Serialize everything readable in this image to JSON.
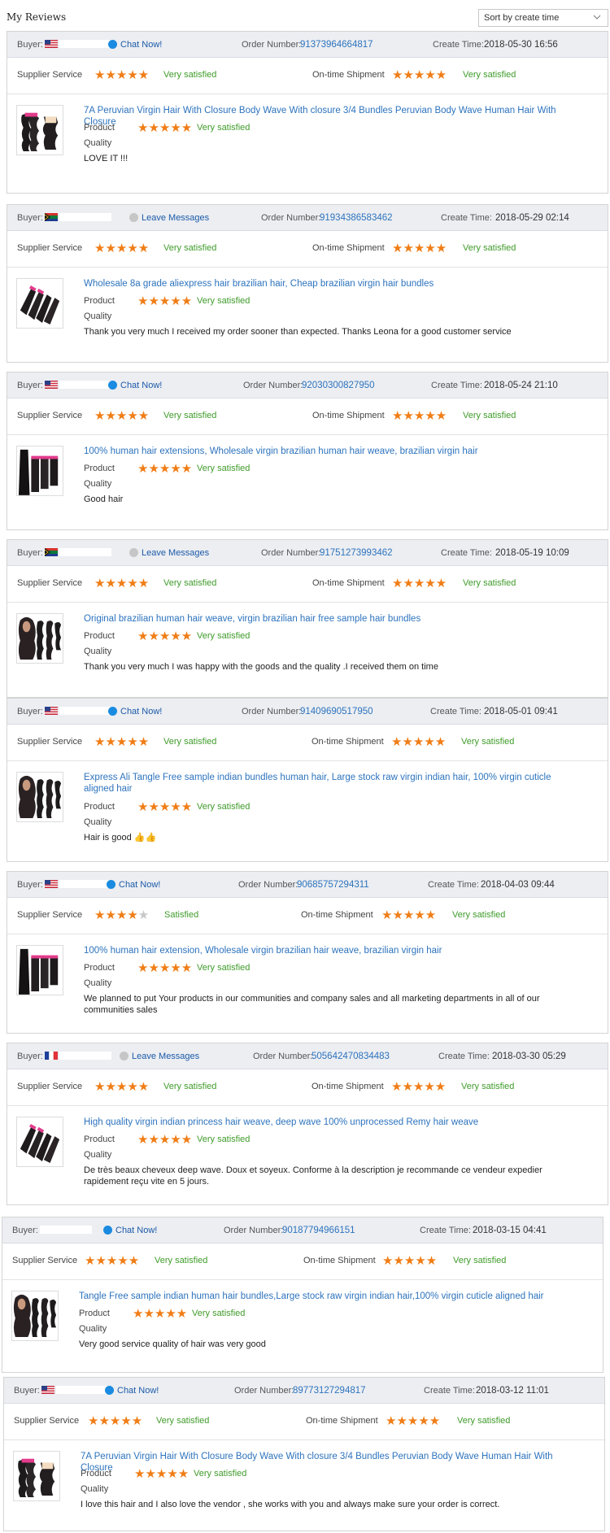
{
  "page": {
    "title": "My Reviews",
    "sort": "Sort by create time"
  },
  "labels": {
    "buyer": "Buyer:",
    "order_number": "Order Number:",
    "create_time": "Create Time:",
    "supplier_service": "Supplier Service",
    "on_time_shipment": "On-time Shipment",
    "product": "Product",
    "quality": "Quality"
  },
  "colors": {
    "header_bg": "#eceef2",
    "link": "#2d73bd",
    "star": "#f07d16",
    "satisfied": "#3f9b2a"
  },
  "reviews": [
    {
      "buyer_flag": "us-flag",
      "contact": "Chat Now!",
      "contact_icon": "chat-icon",
      "order_number": "91373964664817",
      "create_time": "2018-05-30 16:56",
      "supplier_stars": 5,
      "supplier_text": "Very satisfied",
      "shipment_stars": 5,
      "shipment_text": "Very satisfied",
      "product_title": "7A Peruvian Virgin Hair With Closure Body Wave With closure 3/4 Bundles Peruvian Body Wave Human Hair With Closure",
      "product_stars": 5,
      "product_text": "Very satisfied",
      "comment": "LOVE IT !!!",
      "thumb": "bundles-closure"
    },
    {
      "buyer_flag": "za-flag",
      "contact": "Leave Messages",
      "contact_icon": "message-icon",
      "order_number": "91934386583462",
      "create_time": "2018-05-29 02:14",
      "supplier_stars": 5,
      "supplier_text": "Very satisfied",
      "shipment_stars": 5,
      "shipment_text": "Very satisfied",
      "product_title": "Wholesale 8a grade aliexpress hair brazilian hair, Cheap brazilian virgin hair bundles",
      "product_stars": 5,
      "product_text": "Very satisfied",
      "comment": "Thank you very much I received my order sooner than expected. Thanks Leona for a good customer service",
      "thumb": "deep-bundles"
    },
    {
      "buyer_flag": "us-flag",
      "contact": "Chat Now!",
      "contact_icon": "chat-icon",
      "order_number": "92030300827950",
      "create_time": "2018-05-24 21:10",
      "supplier_stars": 5,
      "supplier_text": "Very satisfied",
      "shipment_stars": 5,
      "shipment_text": "Very satisfied",
      "product_title": "100% human hair extensions, Wholesale virgin brazilian human hair weave, brazilian virgin hair",
      "product_stars": 5,
      "product_text": "Very satisfied",
      "comment": "Good hair",
      "thumb": "straight-bundles"
    },
    {
      "buyer_flag": "za-flag",
      "contact": "Leave Messages",
      "contact_icon": "message-icon",
      "order_number": "91751273993462",
      "create_time": "2018-05-19 10:09",
      "supplier_stars": 5,
      "supplier_text": "Very satisfied",
      "shipment_stars": 5,
      "shipment_text": "Very satisfied",
      "product_title": "Original brazilian human hair weave, virgin brazilian hair free sample hair bundles",
      "product_stars": 5,
      "product_text": "Very satisfied",
      "comment": "Thank you very much I was happy with the goods and the quality .I received them on time",
      "thumb": "model-wave"
    },
    {
      "buyer_flag": "us-flag",
      "contact": "Chat Now!",
      "contact_icon": "chat-icon",
      "order_number": "91409690517950",
      "create_time": "2018-05-01 09:41",
      "supplier_stars": 5,
      "supplier_text": "Very satisfied",
      "shipment_stars": 5,
      "shipment_text": "Very satisfied",
      "product_title": "Express Ali Tangle Free sample indian bundles human hair, Large stock raw virgin indian hair, 100% virgin cuticle aligned hair",
      "product_stars": 5,
      "product_text": "Very satisfied",
      "comment": "Hair is good 👍👍",
      "thumb": "model-wave"
    },
    {
      "buyer_flag": "us-flag",
      "contact": "Chat Now!",
      "contact_icon": "chat-icon",
      "order_number": "90685757294311",
      "create_time": "2018-04-03 09:44",
      "supplier_stars": 4,
      "supplier_text": "Satisfied",
      "shipment_stars": 5,
      "shipment_text": "Very satisfied",
      "product_title": "100% human hair extension, Wholesale virgin brazilian hair weave, brazilian virgin hair",
      "product_stars": 5,
      "product_text": "Very satisfied",
      "comment": "We planned to put Your products in our communities and company sales and all marketing departments in all of our communities sales",
      "thumb": "straight-bundles"
    },
    {
      "buyer_flag": "fr-flag",
      "contact": "Leave Messages",
      "contact_icon": "message-icon",
      "order_number": "505642470834483",
      "create_time": "2018-03-30 05:29",
      "supplier_stars": 5,
      "supplier_text": "Very satisfied",
      "shipment_stars": 5,
      "shipment_text": "Very satisfied",
      "product_title": "High quality virgin indian princess hair weave, deep wave 100% unprocessed Remy hair weave",
      "product_stars": 5,
      "product_text": "Very satisfied",
      "comment": "De très beaux cheveux deep wave. Doux et soyeux. Conforme à la description je recommande ce vendeur expedier rapidement reçu vite en 5 jours.",
      "thumb": "deep-bundles"
    },
    {
      "buyer_flag": "none",
      "contact": "Chat Now!",
      "contact_icon": "chat-icon",
      "order_number": "90187794966151",
      "create_time": "2018-03-15 04:41",
      "supplier_stars": 5,
      "supplier_text": "Very satisfied",
      "shipment_stars": 5,
      "shipment_text": "Very satisfied",
      "product_title": "Tangle Free sample indian human hair bundles,Large stock raw virgin indian hair,100% virgin cuticle aligned hair",
      "product_stars": 5,
      "product_text": "Very satisfied",
      "comment": "Very good service quality of hair was very good",
      "thumb": "model-wave"
    },
    {
      "buyer_flag": "us-flag",
      "contact": "Chat Now!",
      "contact_icon": "chat-icon",
      "order_number": "89773127294817",
      "create_time": "2018-03-12 11:01",
      "supplier_stars": 5,
      "supplier_text": "Very satisfied",
      "shipment_stars": 5,
      "shipment_text": "Very satisfied",
      "product_title": "7A Peruvian Virgin Hair With Closure Body Wave With closure 3/4 Bundles Peruvian Body Wave Human Hair With Closure",
      "product_stars": 5,
      "product_text": "Very satisfied",
      "comment": "I love this hair and I also love the vendor , she works with you and always make sure your order is correct.",
      "thumb": "bundles-closure"
    }
  ]
}
